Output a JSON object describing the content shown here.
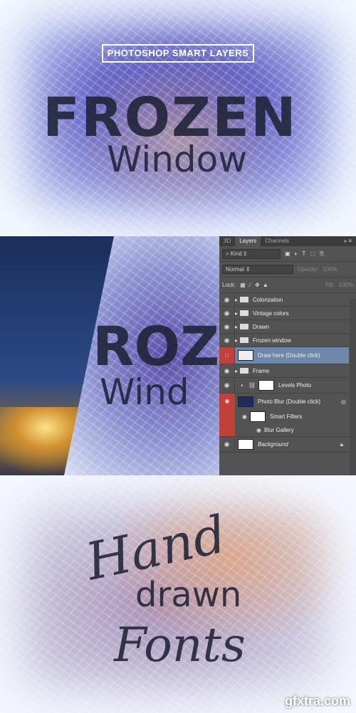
{
  "top": {
    "banner": "PHOTOSHOP SMART LAYERS",
    "title1": "FROZEN",
    "title2": "Window"
  },
  "middle": {
    "art1": "ROZ",
    "art2": "Wind"
  },
  "panel": {
    "tabs": [
      {
        "label": "3D"
      },
      {
        "label": "Layers"
      },
      {
        "label": "Channels"
      }
    ],
    "filter": "Kind",
    "blend_mode": "Normal",
    "opacity_label": "Opacity:",
    "opacity": "100%",
    "lock_label": "Lock:",
    "fill_label": "Fill:",
    "fill": "100%",
    "layers": [
      {
        "name": "Colorization",
        "type": "group"
      },
      {
        "name": "Vintage colors",
        "type": "group"
      },
      {
        "name": "Drawn",
        "type": "group"
      },
      {
        "name": "Frozen window",
        "type": "group"
      },
      {
        "name": "Draw here (Double click)",
        "type": "smart",
        "selected": true
      },
      {
        "name": "Frame",
        "type": "group"
      },
      {
        "name": "Levels Photo",
        "type": "adjustment"
      },
      {
        "name": "Photo Blur (Double click)",
        "type": "smart"
      },
      {
        "name": "Smart Filters",
        "type": "filter"
      },
      {
        "name": "Blur Gallery",
        "type": "filter-item"
      },
      {
        "name": "Background",
        "type": "background",
        "locked": true
      }
    ]
  },
  "bottom": {
    "line1": "Hand",
    "line2": "drawn",
    "line3": "Fonts",
    "watermark": "gfxtra.com"
  },
  "colors": {
    "panel": "#535353",
    "selected": "#6e88ac",
    "red": "#c0403c"
  }
}
